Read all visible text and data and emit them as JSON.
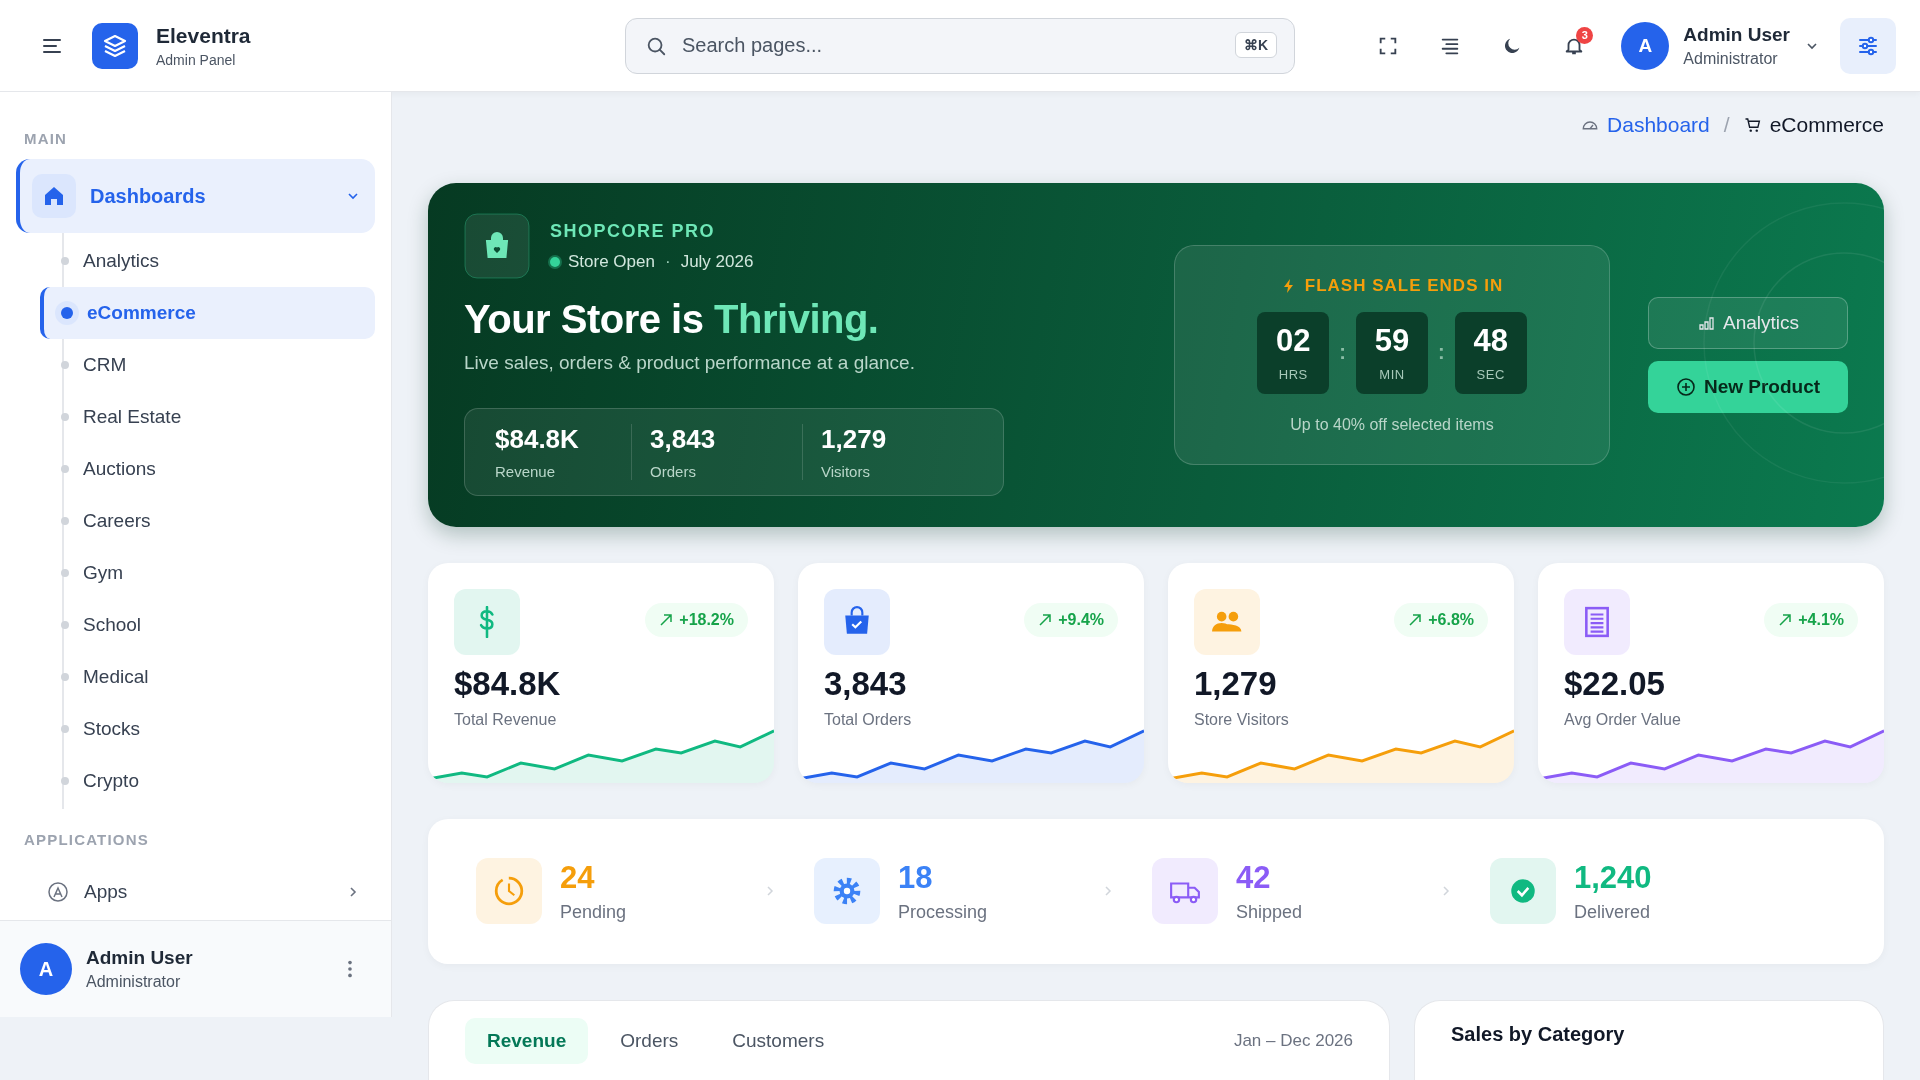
{
  "topbar": {
    "brand": "Eleventra",
    "subtitle": "Admin Panel",
    "search": {
      "placeholder": "Search pages...",
      "shortcut": "⌘K"
    },
    "notifications": "3",
    "user": {
      "initial": "A",
      "name": "Admin User",
      "role": "Administrator"
    }
  },
  "sidebar": {
    "sections": [
      {
        "title": "MAIN",
        "items": [
          {
            "label": "Dashboards",
            "expanded": true,
            "selected": true,
            "children": [
              {
                "label": "Analytics",
                "selected": false
              },
              {
                "label": "eCommerce",
                "selected": true
              },
              {
                "label": "CRM",
                "selected": false
              },
              {
                "label": "Real Estate",
                "selected": false
              },
              {
                "label": "Auctions",
                "selected": false
              },
              {
                "label": "Careers",
                "selected": false
              },
              {
                "label": "Gym",
                "selected": false
              },
              {
                "label": "School",
                "selected": false
              },
              {
                "label": "Medical",
                "selected": false
              },
              {
                "label": "Stocks",
                "selected": false
              },
              {
                "label": "Crypto",
                "selected": false
              }
            ]
          }
        ]
      },
      {
        "title": "APPLICATIONS",
        "items": [
          {
            "label": "Apps",
            "expanded": false,
            "selected": false
          }
        ]
      }
    ],
    "footer": {
      "initial": "A",
      "name": "Admin User",
      "role": "Administrator"
    }
  },
  "breadcrumb": [
    {
      "label": "Dashboard",
      "kind": "link"
    },
    {
      "label": "/",
      "kind": "separator"
    },
    {
      "label": "eCommerce",
      "kind": "current"
    }
  ],
  "hero": {
    "brand": "SHOPCORE PRO",
    "status": "Store Open",
    "dot": "·",
    "date": "July 2026",
    "title": "Your Store is ",
    "title_highlight": "Thriving.",
    "subtitle": "Live sales, orders & product performance at a glance.",
    "stats": [
      {
        "value": "$84.8K",
        "label": "Revenue"
      },
      {
        "value": "3,843",
        "label": "Orders"
      },
      {
        "value": "1,279",
        "label": "Visitors"
      }
    ],
    "flash": {
      "title": "FLASH SALE ENDS IN",
      "units": [
        {
          "value": "02",
          "label": "HRS"
        },
        {
          "value": "59",
          "label": "MIN"
        },
        {
          "value": "48",
          "label": "SEC"
        }
      ],
      "separator": ":",
      "note": "Up to 40% off selected items"
    },
    "buttons": [
      {
        "label": "Analytics",
        "kind": "outline"
      },
      {
        "label": "New Product",
        "kind": "primary"
      }
    ]
  },
  "stat_cards": [
    {
      "kind": "dollar",
      "value": "$84.8K",
      "label": "Total Revenue",
      "change": "+18.2%",
      "color": "#10b981"
    },
    {
      "kind": "bag",
      "value": "3,843",
      "label": "Total Orders",
      "change": "+9.4%",
      "color": "#2563eb"
    },
    {
      "kind": "users",
      "value": "1,279",
      "label": "Store Visitors",
      "change": "+6.8%",
      "color": "#f59e0b"
    },
    {
      "kind": "receipt",
      "value": "$22.05",
      "label": "Avg Order Value",
      "change": "+4.1%",
      "color": "#8b5cf6"
    }
  ],
  "order_status": [
    {
      "kind": "clock",
      "value": "24",
      "label": "Pending",
      "color": "#f59e0b"
    },
    {
      "kind": "gear",
      "value": "18",
      "label": "Processing",
      "color": "#3b82f6"
    },
    {
      "kind": "truck",
      "value": "42",
      "label": "Shipped",
      "color": "#8b5cf6"
    },
    {
      "kind": "check",
      "value": "1,240",
      "label": "Delivered",
      "color": "#10b981"
    }
  ],
  "sales_panel": {
    "tabs": [
      {
        "label": "Revenue",
        "selected": true
      },
      {
        "label": "Orders",
        "selected": false
      },
      {
        "label": "Customers",
        "selected": false
      }
    ],
    "range": "Jan – Dec 2026"
  },
  "category_panel": {
    "title": "Sales by Category"
  }
}
